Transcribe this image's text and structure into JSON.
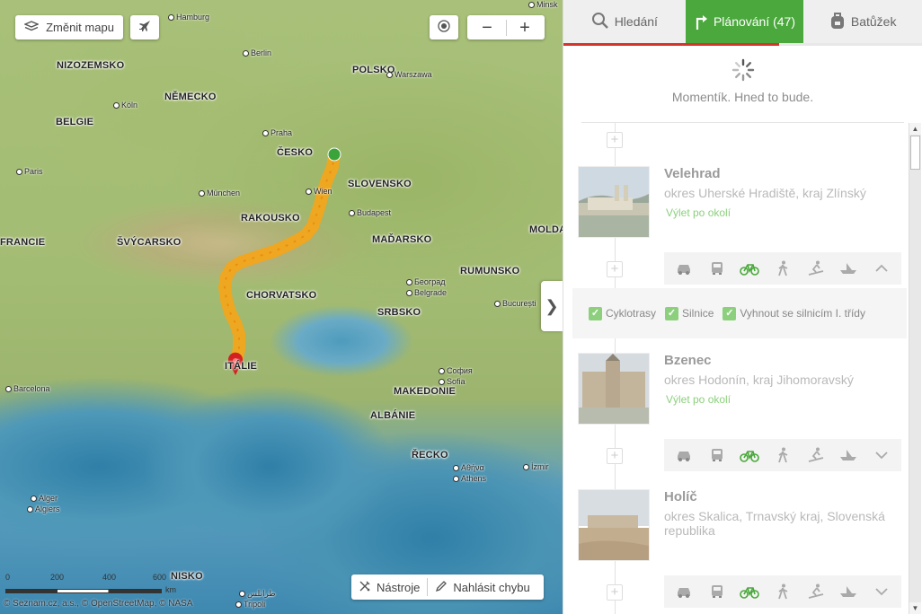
{
  "map": {
    "change_map_label": "Změnit mapu",
    "countries": [
      {
        "text": "NIZOZEMSKO"
      },
      {
        "text": "NĚMECKO"
      },
      {
        "text": "POLSKO"
      },
      {
        "text": "BELGIE"
      },
      {
        "text": "ČESKO"
      },
      {
        "text": "SLOVENSKO"
      },
      {
        "text": "FRANCIE"
      },
      {
        "text": "ŠVÝCARSKO"
      },
      {
        "text": "RAKOUSKO"
      },
      {
        "text": "MAĎARSKO"
      },
      {
        "text": "MOLDA"
      },
      {
        "text": "RUMUNSKO"
      },
      {
        "text": "CHORVATSKO"
      },
      {
        "text": "SRBSKO"
      },
      {
        "text": "ITÁLIE"
      },
      {
        "text": "MAKEDONIE"
      },
      {
        "text": "ALBÁNIE"
      },
      {
        "text": "ŘECKO"
      },
      {
        "text": "NISKO"
      }
    ],
    "cities": [
      {
        "text": "Hamburg"
      },
      {
        "text": "Minsk"
      },
      {
        "text": "Berlin"
      },
      {
        "text": "Warszawa"
      },
      {
        "text": "Köln"
      },
      {
        "text": "Praha"
      },
      {
        "text": "Paris"
      },
      {
        "text": "München"
      },
      {
        "text": "Wien"
      },
      {
        "text": "Budapest"
      },
      {
        "text": "Београд"
      },
      {
        "text": "Belgrade"
      },
      {
        "text": "București"
      },
      {
        "text": "София"
      },
      {
        "text": "Sofia"
      },
      {
        "text": "Barcelona"
      },
      {
        "text": "Αθήνα"
      },
      {
        "text": "Athens"
      },
      {
        "text": "İzmir"
      },
      {
        "text": "Alger"
      },
      {
        "text": "Algiers"
      },
      {
        "text": "طرابلس"
      },
      {
        "text": "Tripoli"
      }
    ],
    "scale": {
      "ticks": [
        "0",
        "200",
        "400",
        "600"
      ],
      "unit": "km"
    },
    "copyright": "© Seznam.cz, a.s., © OpenStreetMap, © NASA",
    "tools_label": "Nástroje",
    "report_label": "Nahlásit chybu",
    "collapse_glyph": "❯"
  },
  "tabs": [
    {
      "label": "Hledání",
      "icon": "search-icon"
    },
    {
      "label": "Plánování (47)",
      "icon": "route-icon"
    },
    {
      "label": "Batůžek",
      "icon": "backpack-icon"
    }
  ],
  "loading": {
    "message": "Momentík. Hned to bude."
  },
  "places": [
    {
      "name": "Velehrad",
      "region": "okres Uherské Hradiště, kraj Zlínský",
      "trip": "Výlet po okolí"
    },
    {
      "name": "Bzenec",
      "region": "okres Hodonín, kraj Jihomoravský",
      "trip": "Výlet po okolí"
    },
    {
      "name": "Holíč",
      "region": "okres Skalica, Trnavský kraj, Slovenská republika",
      "trip": ""
    }
  ],
  "route_options": [
    {
      "label": "Cyklotrasy",
      "checked": true
    },
    {
      "label": "Silnice",
      "checked": true
    },
    {
      "label": "Vyhnout se silnicím I. třídy",
      "checked": true
    }
  ],
  "colors": {
    "accent": "#4aa83c",
    "tab_underline": "#d4342a",
    "route": "#f2a51c",
    "start": "#3aa33a",
    "end": "#d42020"
  }
}
